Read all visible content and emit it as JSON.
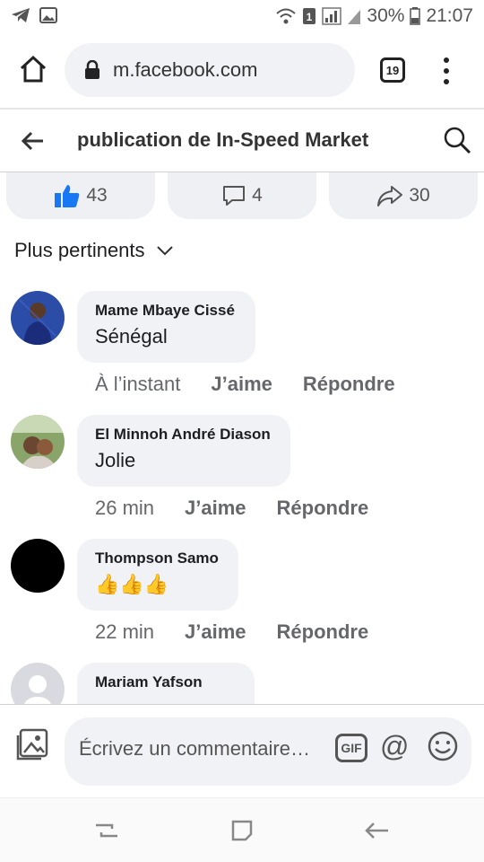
{
  "status_bar": {
    "battery": "30%",
    "time": "21:07"
  },
  "browser": {
    "url": "m.facebook.com",
    "tab_count": "19"
  },
  "page": {
    "title": "publication de In-Speed Market"
  },
  "reactions": {
    "likes": "43",
    "comments": "4",
    "shares": "30"
  },
  "sort_label": "Plus pertinents",
  "comments": [
    {
      "name": "Mame Mbaye Cissé",
      "text": "Sénégal",
      "time": "À l’instant",
      "like": "J’aime",
      "reply": "Répondre"
    },
    {
      "name": "El Minnoh André Diason",
      "text": "Jolie",
      "time": "26 min",
      "like": "J’aime",
      "reply": "Répondre"
    },
    {
      "name": "Thompson Samo",
      "text": "👍👍👍",
      "time": "22 min",
      "like": "J’aime",
      "reply": "Répondre"
    },
    {
      "name": "Mariam Yafson",
      "text": "",
      "time": "",
      "like": "",
      "reply": ""
    }
  ],
  "composer": {
    "placeholder": "Écrivez un commentaire…",
    "gif_label": "GIF",
    "at_label": "@"
  },
  "colors": {
    "facebook_blue": "#1877f2",
    "bubble_bg": "#f0f2f5",
    "meta_gray": "#65676b"
  },
  "icons": [
    "home-icon",
    "lock-icon",
    "tabs-icon",
    "menu-icon",
    "back-arrow-icon",
    "search-icon",
    "like-icon",
    "comment-icon",
    "share-icon",
    "chevron-down-icon",
    "photo-icon",
    "gif-icon",
    "at-icon",
    "emoji-icon"
  ]
}
